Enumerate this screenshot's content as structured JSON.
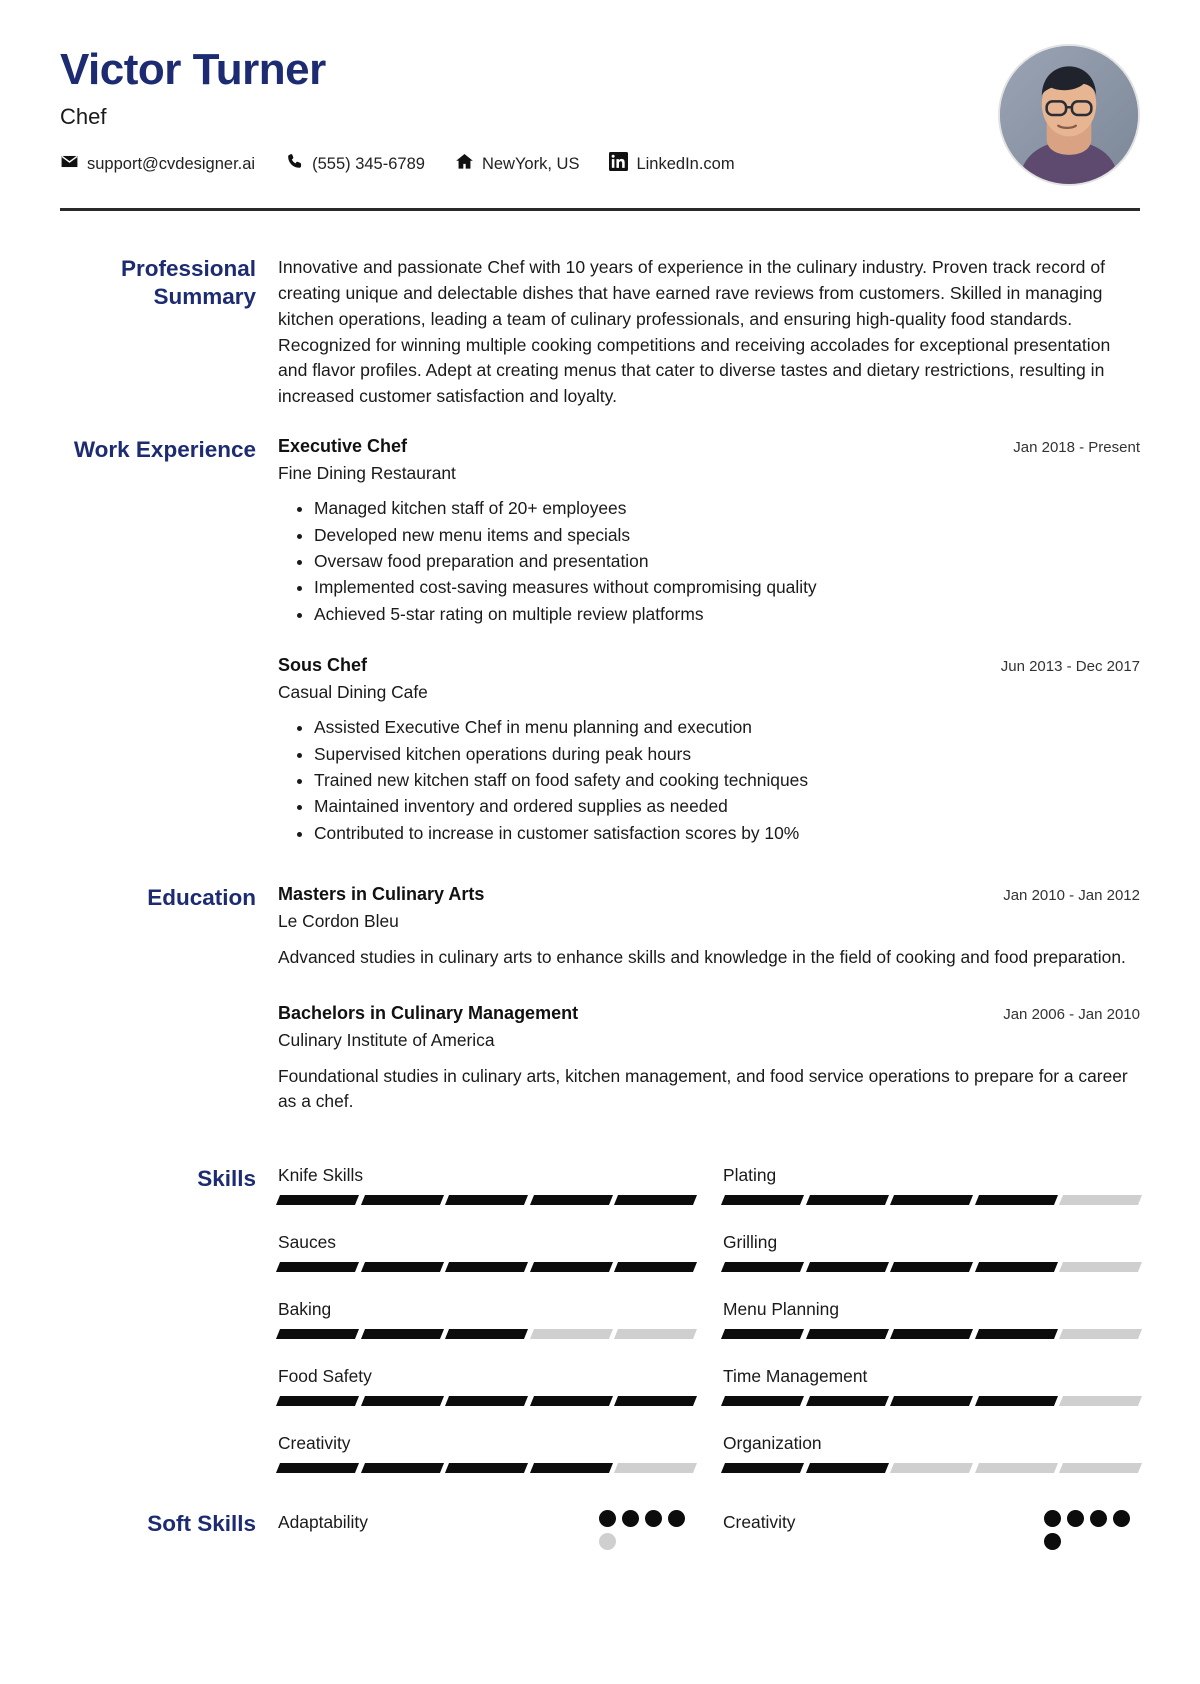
{
  "header": {
    "name": "Victor Turner",
    "role": "Chef",
    "contacts": [
      {
        "icon": "email-icon",
        "text": "support@cvdesigner.ai"
      },
      {
        "icon": "phone-icon",
        "text": "(555) 345-6789"
      },
      {
        "icon": "home-icon",
        "text": "NewYork, US"
      },
      {
        "icon": "linkedin-icon",
        "text": "LinkedIn.com"
      }
    ],
    "photo_alt": "profile-photo"
  },
  "colors": {
    "heading_navy": "#1d2c72",
    "rule": "#2a2a2a",
    "bar_filled": "#0c0c0c",
    "bar_empty": "#cfcfcf"
  },
  "sections": {
    "summary": {
      "label": "Professional Summary",
      "text": "Innovative and passionate Chef with 10 years of experience in the culinary industry. Proven track record of creating unique and delectable dishes that have earned rave reviews from customers. Skilled in managing kitchen operations, leading a team of culinary professionals, and ensuring high-quality food standards. Recognized for winning multiple cooking competitions and receiving accolades for exceptional presentation and flavor profiles. Adept at creating menus that cater to diverse tastes and dietary restrictions, resulting in increased customer satisfaction and loyalty."
    },
    "work": {
      "label": "Work Experience",
      "entries": [
        {
          "title": "Executive Chef",
          "organization": "Fine Dining Restaurant",
          "date": "Jan 2018 - Present",
          "bullets": [
            "Managed kitchen staff of 20+ employees",
            "Developed new menu items and specials",
            "Oversaw food preparation and presentation",
            "Implemented cost-saving measures without compromising quality",
            "Achieved 5-star rating on multiple review platforms"
          ]
        },
        {
          "title": "Sous Chef",
          "organization": "Casual Dining Cafe",
          "date": "Jun 2013 - Dec 2017",
          "bullets": [
            "Assisted Executive Chef in menu planning and execution",
            "Supervised kitchen operations during peak hours",
            "Trained new kitchen staff on food safety and cooking techniques",
            "Maintained inventory and ordered supplies as needed",
            "Contributed to increase in customer satisfaction scores by 10%"
          ]
        }
      ]
    },
    "education": {
      "label": "Education",
      "entries": [
        {
          "title": "Masters in Culinary Arts",
          "organization": "Le Cordon Bleu",
          "date": "Jan 2010 - Jan 2012",
          "description": "Advanced studies in culinary arts to enhance skills and knowledge in the field of cooking and food preparation."
        },
        {
          "title": "Bachelors in Culinary Management",
          "organization": "Culinary Institute of America",
          "date": "Jan 2006 - Jan 2010",
          "description": "Foundational studies in culinary arts, kitchen management, and food service operations to prepare for a career as a chef."
        }
      ]
    },
    "skills": {
      "label": "Skills",
      "max": 5,
      "items": [
        {
          "name": "Knife Skills",
          "level": 5
        },
        {
          "name": "Plating",
          "level": 4
        },
        {
          "name": "Sauces",
          "level": 5
        },
        {
          "name": "Grilling",
          "level": 4
        },
        {
          "name": "Baking",
          "level": 3
        },
        {
          "name": "Menu Planning",
          "level": 4
        },
        {
          "name": "Food Safety",
          "level": 5
        },
        {
          "name": "Time Management",
          "level": 4
        },
        {
          "name": "Creativity",
          "level": 4
        },
        {
          "name": "Organization",
          "level": 2
        }
      ]
    },
    "soft_skills": {
      "label": "Soft Skills",
      "max": 5,
      "items": [
        {
          "name": "Adaptability",
          "level": 4
        },
        {
          "name": "Creativity",
          "level": 5
        }
      ]
    }
  }
}
